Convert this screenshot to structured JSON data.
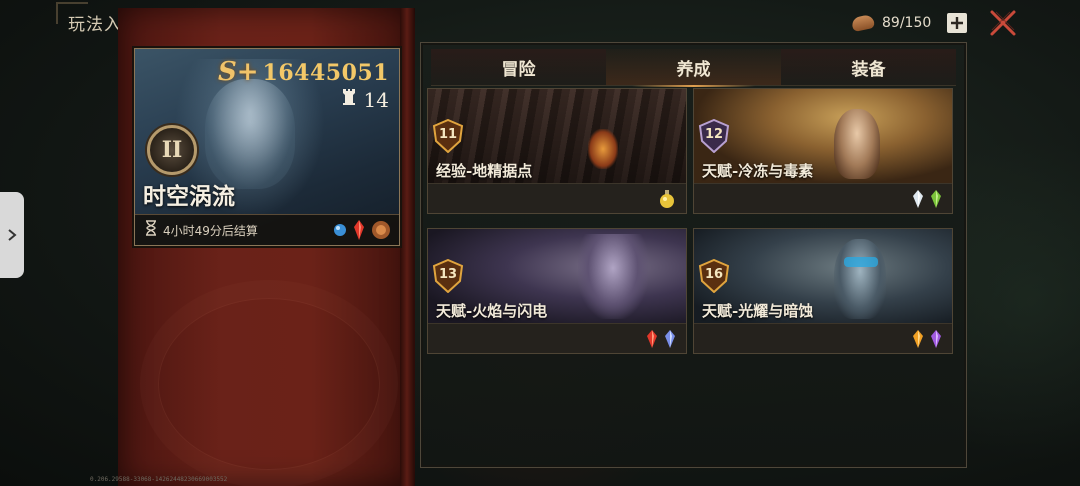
{
  "header": {
    "title": "玩法入口"
  },
  "resource": {
    "amount": "89/150",
    "icon": "bread-icon"
  },
  "featured": {
    "rank": "S+",
    "score": "16445051",
    "floor": "14",
    "tier": "II",
    "name": "时空涡流",
    "countdown": "4小时49分后结算",
    "reward_icons": [
      "blue-orb-icon",
      "red-crystal-icon",
      "bronze-coin-icon"
    ]
  },
  "tabs": [
    {
      "label": "冒险",
      "active": false
    },
    {
      "label": "养成",
      "active": true
    },
    {
      "label": "装备",
      "active": false
    }
  ],
  "entries": [
    {
      "level": "11",
      "title": "经验-地精据点",
      "rewards": [
        "potion-icon"
      ]
    },
    {
      "level": "12",
      "title": "天赋-冷冻与毒素",
      "rewards": [
        "white-crystal-icon",
        "green-crystal-icon"
      ]
    },
    {
      "level": "13",
      "title": "天赋-火焰与闪电",
      "rewards": [
        "red-crystal-icon",
        "blue-crystal-icon"
      ]
    },
    {
      "level": "16",
      "title": "天赋-光耀与暗蚀",
      "rewards": [
        "orange-crystal-icon",
        "purple-crystal-icon"
      ]
    }
  ],
  "footer": {
    "build_string": "0.206.29588-33068-14262448230669003552"
  },
  "colors": {
    "gold": "#f3c868",
    "banner": "#6a2219",
    "panel_border": "#4e473a"
  }
}
